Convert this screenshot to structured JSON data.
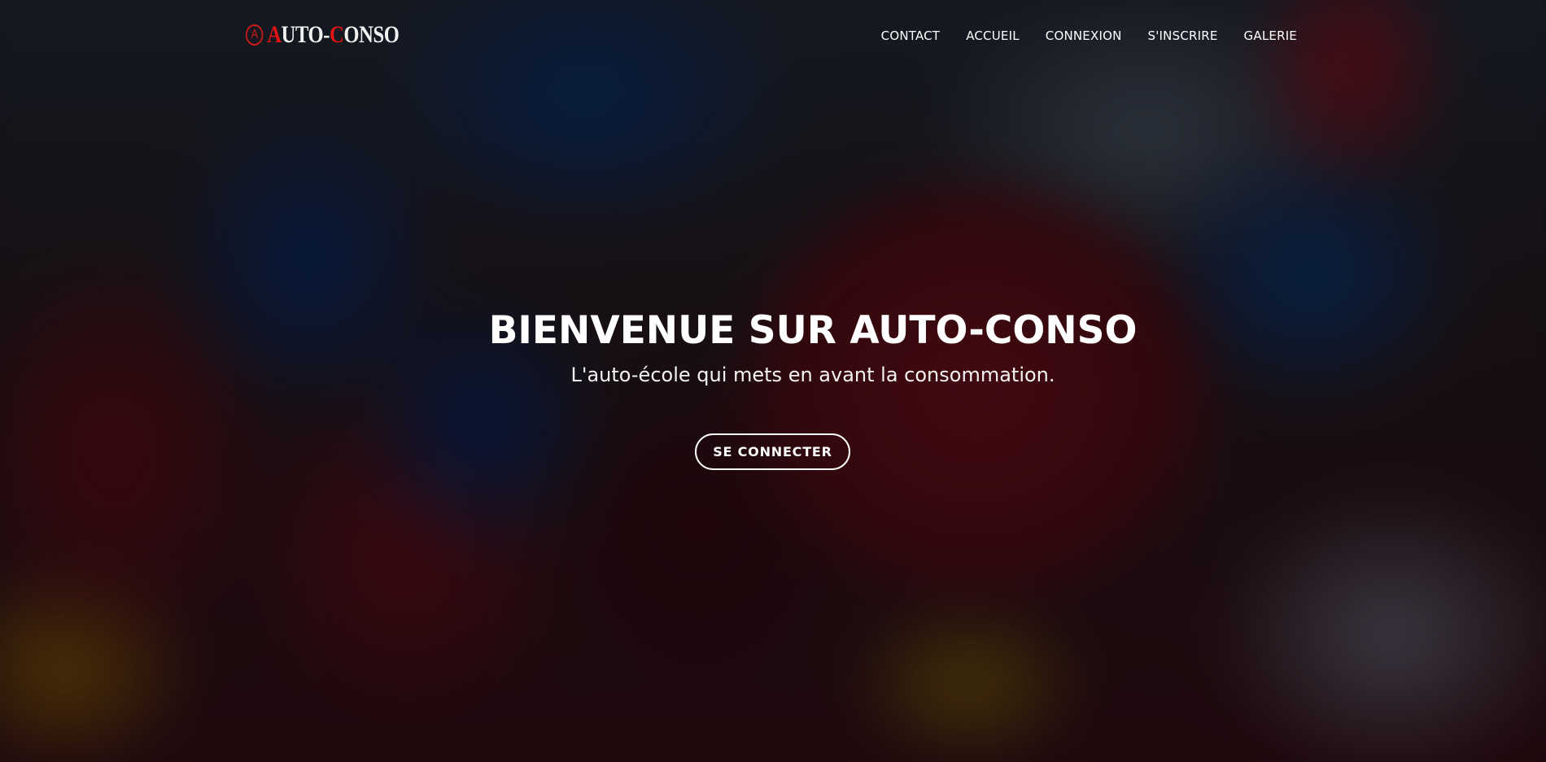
{
  "header": {
    "logo": {
      "mark": "A",
      "first_letter": "A",
      "text_part1": "UTO-",
      "second_letter": "C",
      "text_part2": "ONSO"
    },
    "nav": [
      {
        "label": "CONTACT"
      },
      {
        "label": "ACCUEIL"
      },
      {
        "label": "CONNEXION"
      },
      {
        "label": "S'INSCRIRE"
      },
      {
        "label": "GALERIE"
      }
    ]
  },
  "hero": {
    "title": "BIENVENUE SUR AUTO-CONSO",
    "subtitle": "L'auto-école qui mets en avant la consommation.",
    "cta_label": "SE CONNECTER"
  },
  "colors": {
    "brand_red": "#e01414",
    "text": "#ffffff"
  }
}
